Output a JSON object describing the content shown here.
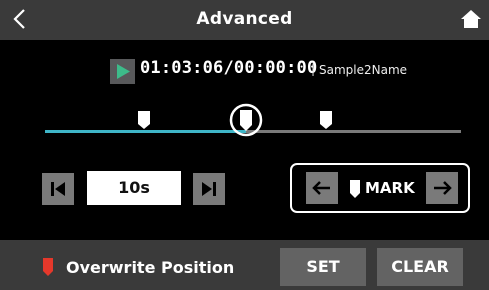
{
  "header": {
    "title": "Advanced",
    "back_icon": "chevron-left-icon",
    "home_icon": "home-icon"
  },
  "status": {
    "play_icon": "play-icon",
    "time": "01:03:06/00:00:00",
    "separator": "|",
    "file_name": "Sample2Name"
  },
  "timeline": {
    "progress": 0.49,
    "marks": [
      0.24,
      0.68
    ]
  },
  "skip": {
    "prev_icon": "skip-previous-icon",
    "value": "10s",
    "next_icon": "skip-next-icon"
  },
  "mark": {
    "left_icon": "arrow-left-icon",
    "mark_icon": "mark-icon",
    "label": "MARK",
    "right_icon": "arrow-right-icon"
  },
  "footer": {
    "pin_icon": "overwrite-marker-icon",
    "label": "Overwrite Position",
    "set_label": "SET",
    "clear_label": "CLEAR"
  },
  "colors": {
    "accent": "#3fb6c8",
    "play": "#3dbb8a",
    "pin": "#e5382b",
    "header_bg": "#3a3a3a",
    "button_bg": "#7a7a7a"
  }
}
